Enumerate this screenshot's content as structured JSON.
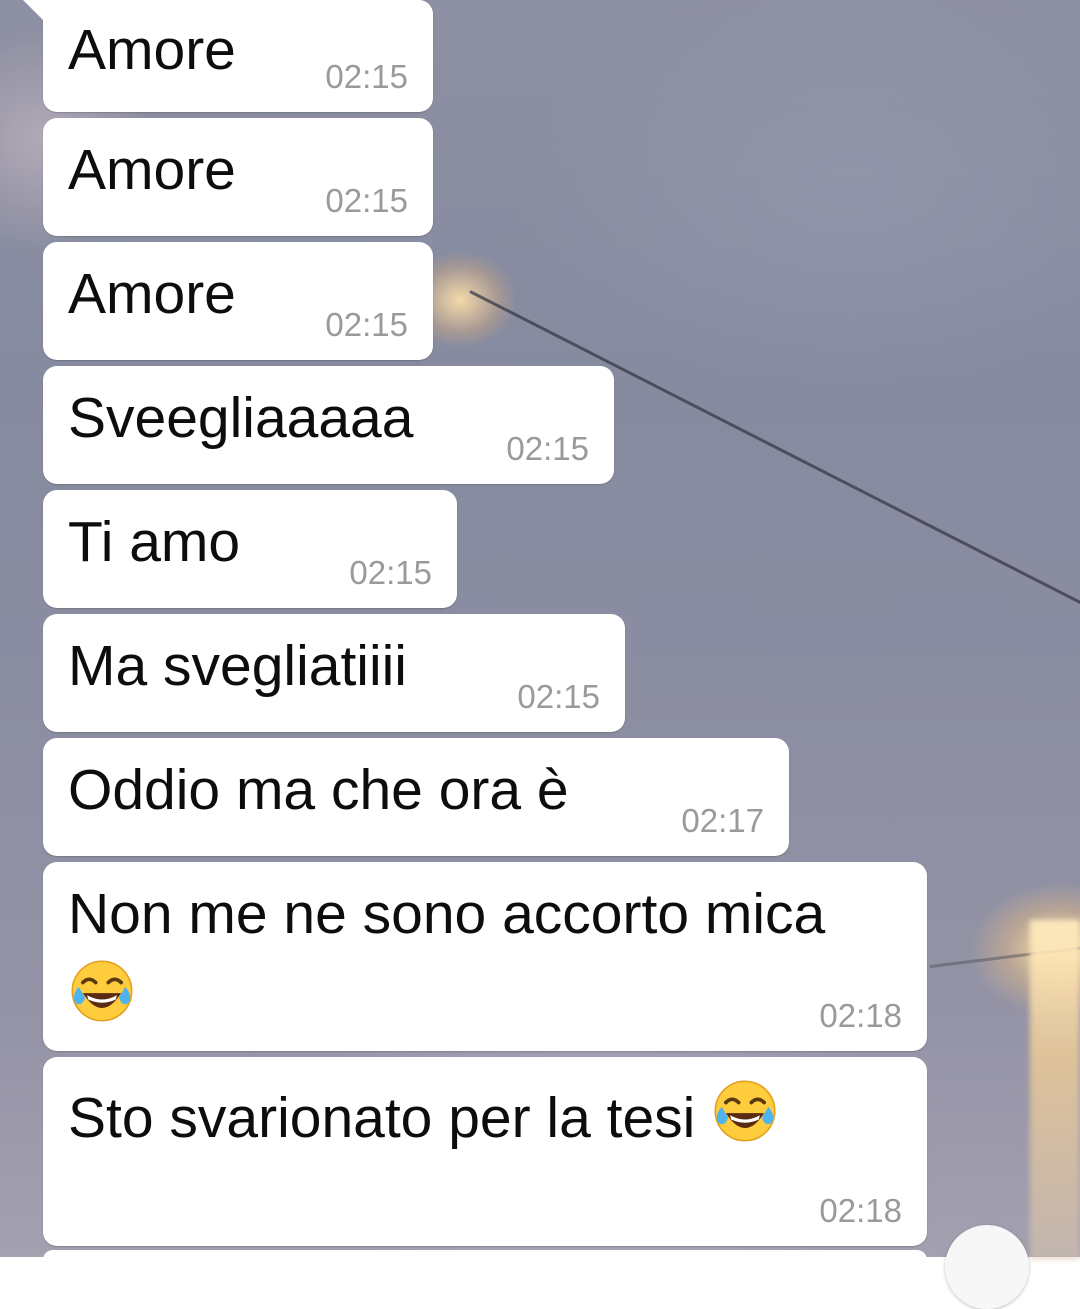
{
  "messages": [
    {
      "text": "Amore",
      "time": "02:15"
    },
    {
      "text": "Amore",
      "time": "02:15"
    },
    {
      "text": "Amore",
      "time": "02:15"
    },
    {
      "text": "Sveegliaaaaa",
      "time": "02:15"
    },
    {
      "text": "Ti amo",
      "time": "02:15"
    },
    {
      "text": "Ma svegliatiiii",
      "time": "02:15"
    },
    {
      "text": "Oddio ma che ora è",
      "time": "02:17"
    },
    {
      "text": "Non me ne sono accorto mica",
      "time": "02:18",
      "emoji": "face-with-tears-of-joy"
    },
    {
      "text": "Sto svarionato per la tesi",
      "time": "02:18",
      "emoji": "face-with-tears-of-joy"
    }
  ],
  "colors": {
    "bubble": "#ffffff",
    "text": "#0d0d0d",
    "timestamp": "#9a9a9a"
  }
}
